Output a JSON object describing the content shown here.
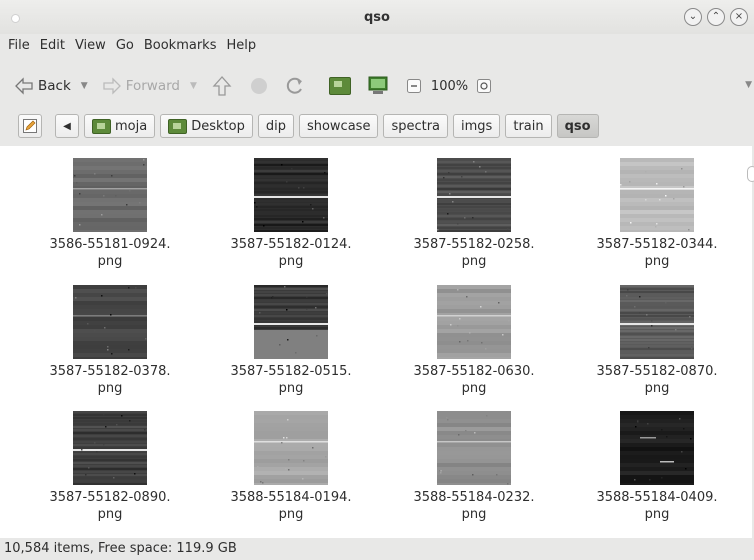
{
  "window": {
    "title": "qso"
  },
  "menu": [
    "File",
    "Edit",
    "View",
    "Go",
    "Bookmarks",
    "Help"
  ],
  "toolbar": {
    "back_label": "Back",
    "forward_label": "Forward",
    "zoom": "100%"
  },
  "breadcrumbs": [
    "moja",
    "Desktop",
    "dip",
    "showcase",
    "spectra",
    "imgs",
    "train",
    "qso"
  ],
  "files": [
    {
      "name": "3586-55181-0924.\npng",
      "tone": "#6b6b6b",
      "style": "noise"
    },
    {
      "name": "3587-55182-0124.\npng",
      "tone": "#2c2c2c",
      "style": "stripes-dark"
    },
    {
      "name": "3587-55182-0258.\npng",
      "tone": "#4d4d4d",
      "style": "stripes"
    },
    {
      "name": "3587-55182-0344.\npng",
      "tone": "#bdbdbd",
      "style": "light"
    },
    {
      "name": "3587-55182-0378.\npng",
      "tone": "#454545",
      "style": "noise"
    },
    {
      "name": "3587-55182-0515.\npng",
      "tone": "#3a3a3a",
      "style": "split"
    },
    {
      "name": "3587-55182-0630.\npng",
      "tone": "#9a9a9a",
      "style": "light"
    },
    {
      "name": "3587-55182-0870.\npng",
      "tone": "#5a5a5a",
      "style": "stripes"
    },
    {
      "name": "3587-55182-0890.\npng",
      "tone": "#3e3e3e",
      "style": "stripes-dark"
    },
    {
      "name": "3588-55184-0194.\npng",
      "tone": "#a8a8a8",
      "style": "light"
    },
    {
      "name": "3588-55184-0232.\npng",
      "tone": "#8f8f8f",
      "style": "light"
    },
    {
      "name": "3588-55184-0409.\npng",
      "tone": "#1c1c1c",
      "style": "dark"
    }
  ],
  "status": "10,584 items, Free space: 119.9 GB"
}
